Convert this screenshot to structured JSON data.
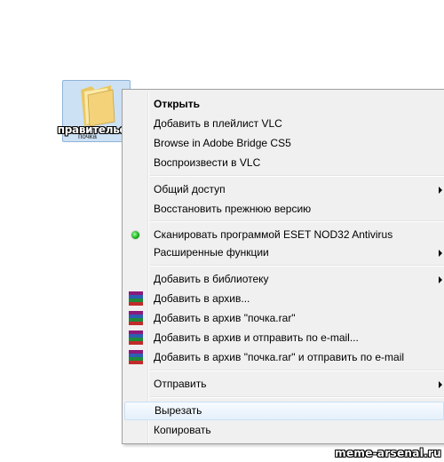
{
  "desktop": {
    "folder_label": "правительство",
    "folder_sub_label": "почка"
  },
  "context_menu": {
    "items": [
      {
        "label": "Открыть"
      },
      {
        "label": "Добавить в плейлист VLC"
      },
      {
        "label": "Browse in Adobe Bridge CS5"
      },
      {
        "label": "Воспроизвести в VLC"
      },
      {
        "label": "Общий доступ"
      },
      {
        "label": "Восстановить прежнюю версию"
      },
      {
        "label": "Сканировать программой ESET NOD32 Antivirus"
      },
      {
        "label": "Расширенные функции"
      },
      {
        "label": "Добавить в библиотеку"
      },
      {
        "label": "Добавить в архив..."
      },
      {
        "label": "Добавить в архив \"почка.rar\""
      },
      {
        "label": "Добавить в архив и отправить по e-mail..."
      },
      {
        "label": "Добавить в архив \"почка.rar\" и отправить по e-mail"
      },
      {
        "label": "Отправить"
      },
      {
        "label": "Вырезать"
      },
      {
        "label": "Копировать"
      }
    ]
  },
  "icons": {
    "folder": "folder-icon",
    "eset": "eset-icon",
    "winrar": "winrar-icon",
    "submenu": "submenu-arrow-icon"
  },
  "colors": {
    "menu_bg": "#f0f0f0",
    "hover_border": "#cbe0f6",
    "selection_bg": "#cde1f5",
    "eset_green": "#11a911"
  },
  "watermark": "meme-arsenal.ru"
}
